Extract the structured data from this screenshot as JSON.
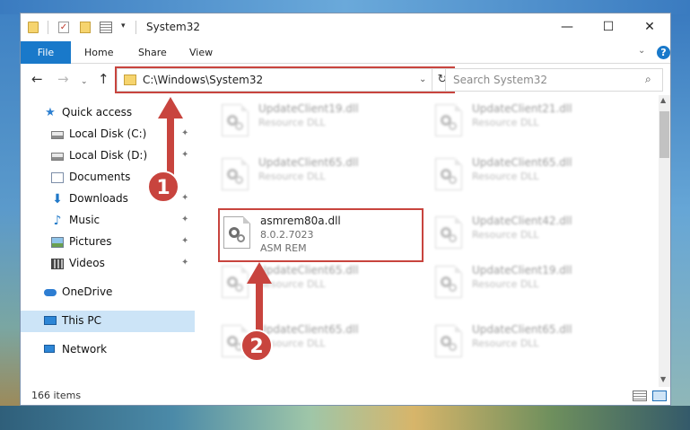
{
  "window": {
    "title": "System32",
    "controls": {
      "minimize": "—",
      "maximize": "☐",
      "close": "✕"
    }
  },
  "quick_access_toolbar": {
    "check_glyph": "✓",
    "dropdown_glyph": "▾"
  },
  "ribbon": {
    "tabs": [
      "File",
      "Home",
      "Share",
      "View"
    ],
    "expand_glyph": "⌄",
    "help_glyph": "?"
  },
  "navigation": {
    "back_glyph": "←",
    "forward_glyph": "→",
    "recent_glyph": "⌄",
    "up_glyph": "↑",
    "address": "C:\\Windows\\System32",
    "address_dropdown_glyph": "⌄",
    "refresh_glyph": "↻",
    "search_placeholder": "Search System32",
    "search_glyph": "⌕"
  },
  "sidebar": {
    "pin_glyph": "✦",
    "items": [
      {
        "label": "Quick access",
        "icon": "star-icon",
        "glyph": "★"
      },
      {
        "label": "Local Disk (C:)",
        "icon": "disk-icon"
      },
      {
        "label": "Local Disk (D:)",
        "icon": "disk-icon"
      },
      {
        "label": "Documents",
        "icon": "documents-icon"
      },
      {
        "label": "Downloads",
        "icon": "download-icon",
        "glyph": "⬇"
      },
      {
        "label": "Music",
        "icon": "music-icon",
        "glyph": "♪"
      },
      {
        "label": "Pictures",
        "icon": "pictures-icon"
      },
      {
        "label": "Videos",
        "icon": "videos-icon"
      },
      {
        "label": "OneDrive",
        "icon": "cloud-icon"
      },
      {
        "label": "This PC",
        "icon": "computer-icon",
        "selected": true
      },
      {
        "label": "Network",
        "icon": "network-icon"
      }
    ]
  },
  "files": [
    {
      "name": "UpdateClient19.dll",
      "line1": "Resource DLL",
      "line2": "",
      "blurred": true
    },
    {
      "name": "UpdateClient21.dll",
      "line1": "Resource DLL",
      "line2": "",
      "blurred": true
    },
    {
      "name": "UpdateClient65.dll",
      "line1": "Resource DLL",
      "line2": "",
      "blurred": true
    },
    {
      "name": "UpdateClient65.dll",
      "line1": "Resource DLL",
      "line2": "",
      "blurred": true
    },
    {
      "name": "asmrem80a.dll",
      "line1": "8.0.2.7023",
      "line2": "ASM REM",
      "blurred": false
    },
    {
      "name": "UpdateClient42.dll",
      "line1": "Resource DLL",
      "line2": "",
      "blurred": true
    },
    {
      "name": "UpdateClient65.dll",
      "line1": "Resource DLL",
      "line2": "",
      "blurred": true
    },
    {
      "name": "UpdateClient19.dll",
      "line1": "Resource DLL",
      "line2": "",
      "blurred": true
    },
    {
      "name": "UpdateClient65.dll",
      "line1": "Resource DLL",
      "line2": "",
      "blurred": true
    },
    {
      "name": "UpdateClient65.dll",
      "line1": "Resource DLL",
      "line2": "",
      "blurred": true
    }
  ],
  "scrollbar": {
    "up_glyph": "▲",
    "down_glyph": "▼"
  },
  "status": {
    "item_count": "166 items"
  },
  "annotations": {
    "badge1": "1",
    "badge2": "2",
    "highlight_color": "#c8443e"
  }
}
